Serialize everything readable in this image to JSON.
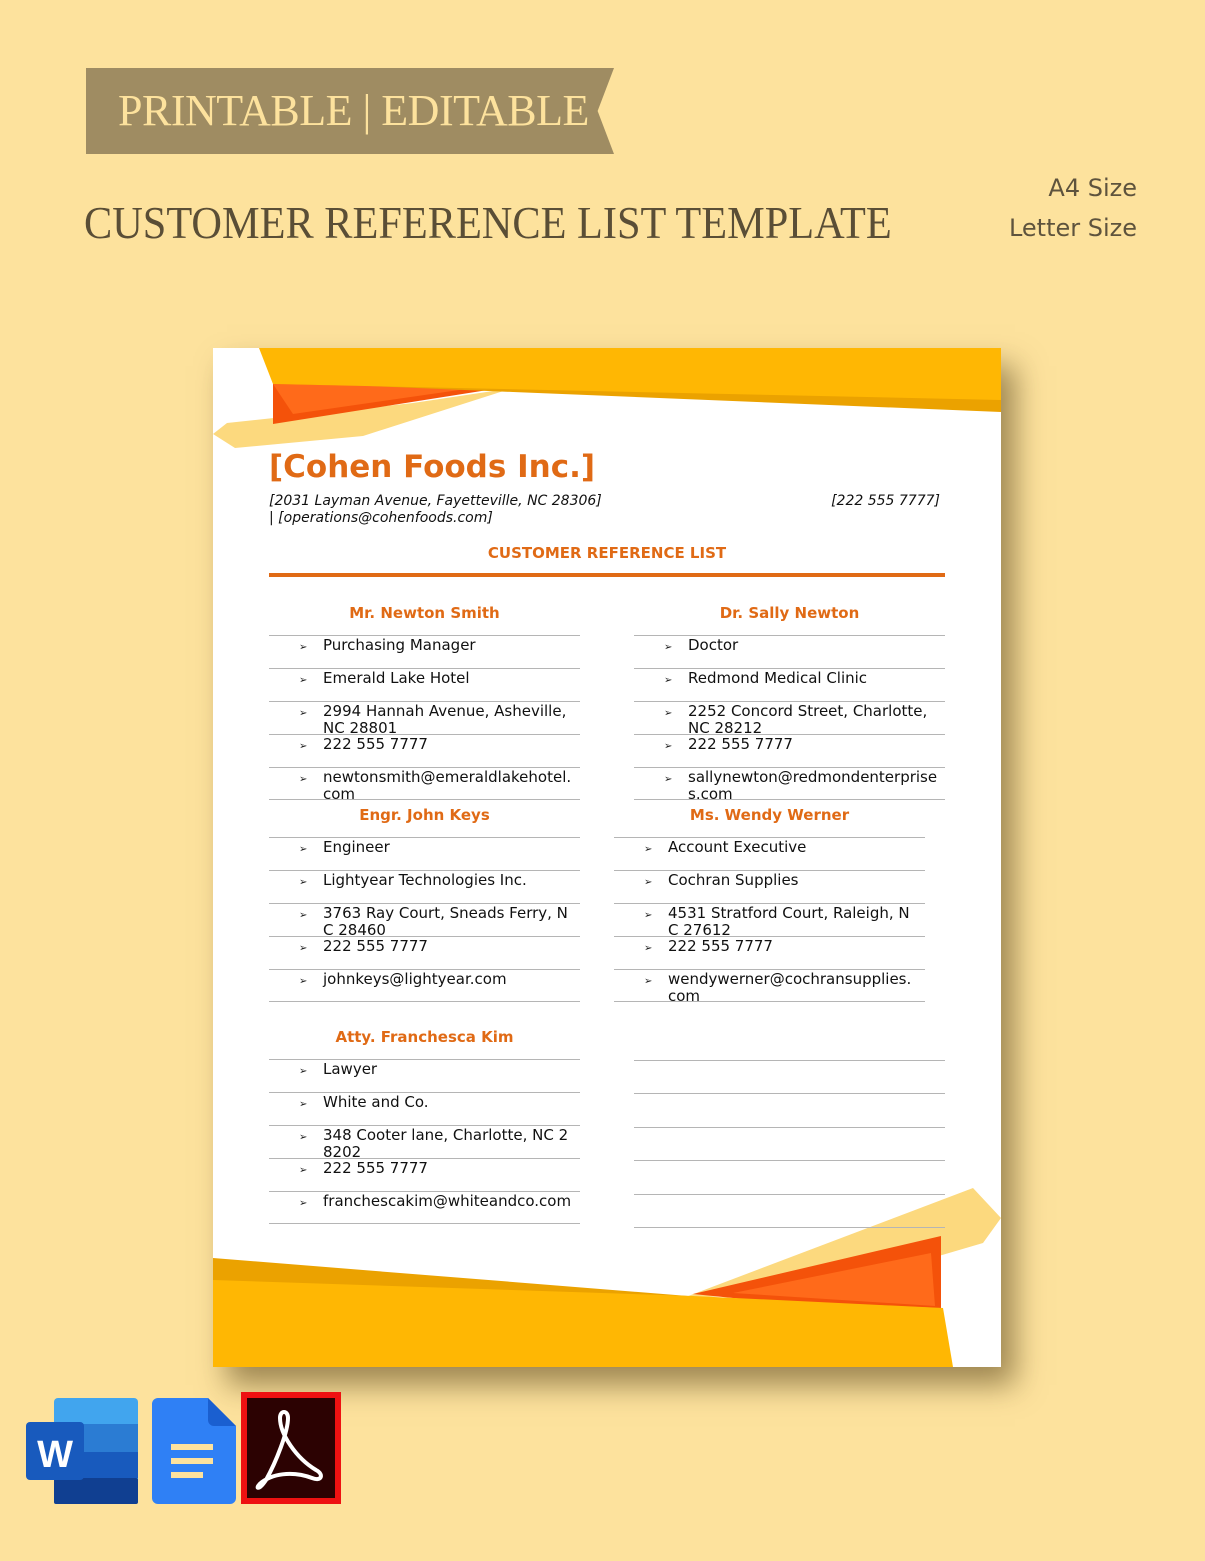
{
  "banner": {
    "ribbon_text": "PRINTABLE | EDITABLE",
    "title": "CUSTOMER REFERENCE LIST TEMPLATE",
    "sizes": [
      "A4 Size",
      "Letter Size"
    ]
  },
  "document": {
    "company_name": "[Cohen Foods Inc.]",
    "address_line1": "[2031 Layman Avenue, Fayetteville, NC 28306]",
    "address_line2": "| [operations@cohenfoods.com]",
    "phone": "[222 555 7777]",
    "heading": "CUSTOMER REFERENCE LIST",
    "references": [
      {
        "name": "Mr. Newton Smith",
        "details": [
          "Purchasing Manager",
          "Emerald Lake Hotel",
          "2994 Hannah Avenue, Asheville, NC 28801",
          "222 555 7777",
          "newtonsmith@emeraldlakehotel.com"
        ]
      },
      {
        "name": "Dr. Sally Newton",
        "details": [
          "Doctor",
          "Redmond Medical Clinic",
          "2252 Concord Street, Charlotte, NC 28212",
          "222 555 7777",
          "sallynewton@redmondenterprises.com"
        ]
      },
      {
        "name": "Engr. John Keys",
        "details": [
          "Engineer",
          "Lightyear Technologies Inc.",
          "3763 Ray Court, Sneads Ferry, NC 28460",
          "222 555 7777",
          "johnkeys@lightyear.com"
        ]
      },
      {
        "name": "Ms. Wendy Werner",
        "details": [
          "Account Executive",
          "Cochran Supplies",
          "4531 Stratford Court, Raleigh, NC 27612",
          "222 555 7777",
          "wendywerner@cochransupplies.com"
        ]
      },
      {
        "name": "Atty. Franchesca Kim",
        "details": [
          "Lawyer",
          "White and Co.",
          "348 Cooter lane, Charlotte, NC 28202",
          "222 555 7777",
          "franchescakim@whiteandco.com"
        ]
      }
    ],
    "bullet_glyph": "➢"
  },
  "formats": [
    {
      "name": "Microsoft Word",
      "letter": "W"
    },
    {
      "name": "Google Docs"
    },
    {
      "name": "Adobe PDF"
    }
  ],
  "colors": {
    "background": "#fde29d",
    "ribbon": "#9f8c62",
    "accent_orange": "#e06a15",
    "yellow": "#ffb703",
    "red_orange": "#f4520a"
  }
}
